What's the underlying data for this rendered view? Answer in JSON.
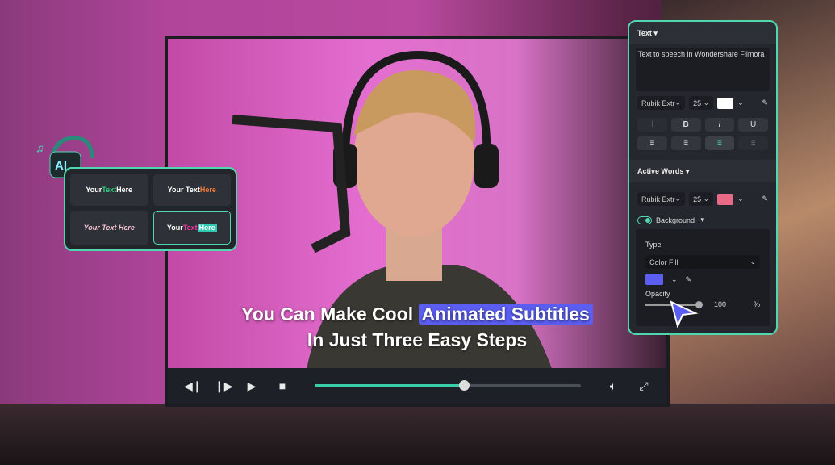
{
  "video": {
    "subtitle_line1_pre": "You Can Make Cool",
    "subtitle_line1_highlight": "Animated Subtitles",
    "subtitle_line2": "In Just Three Easy Steps"
  },
  "controls": {
    "icons": [
      "step-back-icon",
      "step-forward-icon",
      "play-icon",
      "stop-icon",
      "volume-icon",
      "fullscreen-icon"
    ],
    "progress": 0.56
  },
  "templates": [
    {
      "pre": "Your ",
      "mid": "Text",
      "post": " Here",
      "accent": "#2fd07a"
    },
    {
      "pre": "Your Text ",
      "mid": "Here",
      "post": "",
      "accent": "#f07a3a"
    },
    {
      "pre": "Your Text Here",
      "mid": "",
      "post": "",
      "accent": "#f0a0c0"
    },
    {
      "pre": "Your ",
      "mid": "Text",
      "post": "Here",
      "accent": "#f03aa0"
    }
  ],
  "panel": {
    "text_section": "Text",
    "text_value": "Text to speech in Wondershare Filmora",
    "font": "Rubik Extr",
    "size": "25",
    "text_color": "#ffffff",
    "style_buttons": [
      "B",
      "I",
      "U"
    ],
    "active_words": "Active Words",
    "aw_font": "Rubik Extr",
    "aw_size": "25",
    "aw_color": "#e86a86",
    "background_label": "Background",
    "background_on": true,
    "type_label": "Type",
    "type_value": "Color Fill",
    "fill_color": "#5b5ef0",
    "opacity_label": "Opacity",
    "opacity_value": "100",
    "opacity_unit": "%"
  },
  "colors": {
    "accent": "#4fd8b0",
    "highlight": "#5b5ef0"
  }
}
